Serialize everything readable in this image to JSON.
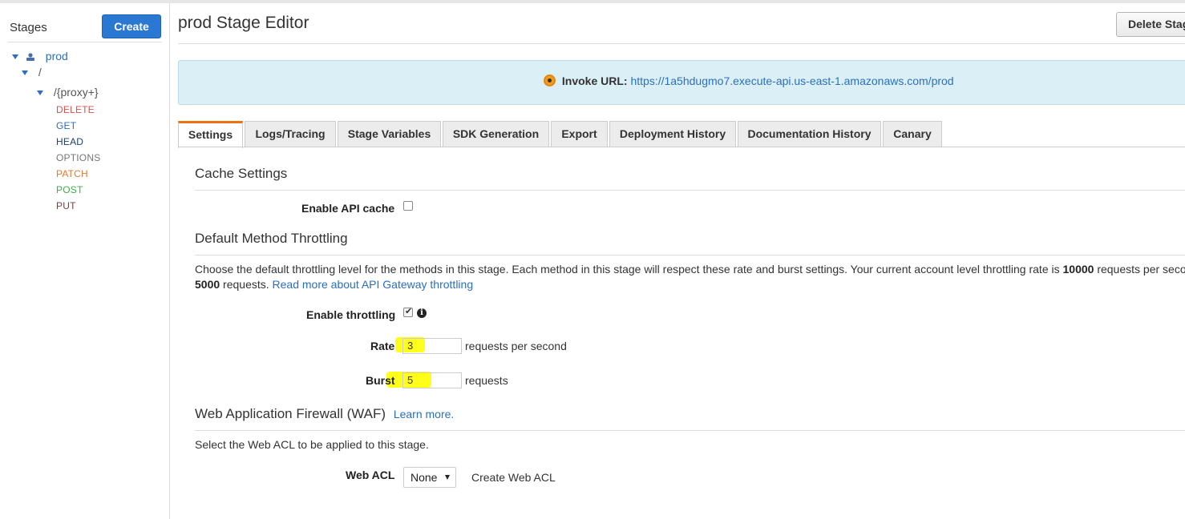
{
  "sidebar": {
    "title": "Stages",
    "create_label": "Create",
    "tree": {
      "stage": "prod",
      "root": "/",
      "resource": "/{proxy+}",
      "methods": [
        {
          "label": "DELETE",
          "color": "#d9534f"
        },
        {
          "label": "GET",
          "color": "#2b6fbf"
        },
        {
          "label": "HEAD",
          "color": "#1f3f6e"
        },
        {
          "label": "OPTIONS",
          "color": "#777777"
        },
        {
          "label": "PATCH",
          "color": "#e07b39"
        },
        {
          "label": "POST",
          "color": "#3fae49"
        },
        {
          "label": "PUT",
          "color": "#7d3d3d"
        }
      ]
    }
  },
  "header": {
    "title": "prod Stage Editor",
    "delete_label": "Delete Stage"
  },
  "invoke": {
    "label": "Invoke URL:",
    "url": "https://1a5hdugmo7.execute-api.us-east-1.amazonaws.com/prod"
  },
  "tabs": [
    {
      "label": "Settings",
      "active": true
    },
    {
      "label": "Logs/Tracing"
    },
    {
      "label": "Stage Variables"
    },
    {
      "label": "SDK Generation"
    },
    {
      "label": "Export"
    },
    {
      "label": "Deployment History"
    },
    {
      "label": "Documentation History"
    },
    {
      "label": "Canary"
    }
  ],
  "cache": {
    "title": "Cache Settings",
    "enable_label": "Enable API cache",
    "enabled": false
  },
  "throttling": {
    "title": "Default Method Throttling",
    "desc_part1": "Choose the default throttling level for the methods in this stage. Each method in this stage will respect these rate and burst settings. Your current account level throttling rate is ",
    "account_rate": "10000",
    "desc_part2": " requests per seco",
    "account_burst": "5000",
    "desc_part3": " requests. ",
    "read_more": "Read more about API Gateway throttling",
    "enable_label": "Enable throttling",
    "enabled": true,
    "rate_label": "Rate",
    "rate_value": "3",
    "rate_unit": "requests per second",
    "burst_label": "Burst",
    "burst_value": "5",
    "burst_unit": "requests"
  },
  "waf": {
    "title": "Web Application Firewall (WAF)",
    "learn_more": "Learn more.",
    "desc": "Select the Web ACL to be applied to this stage.",
    "acl_label": "Web ACL",
    "acl_value": "None",
    "create_link": "Create Web ACL"
  }
}
